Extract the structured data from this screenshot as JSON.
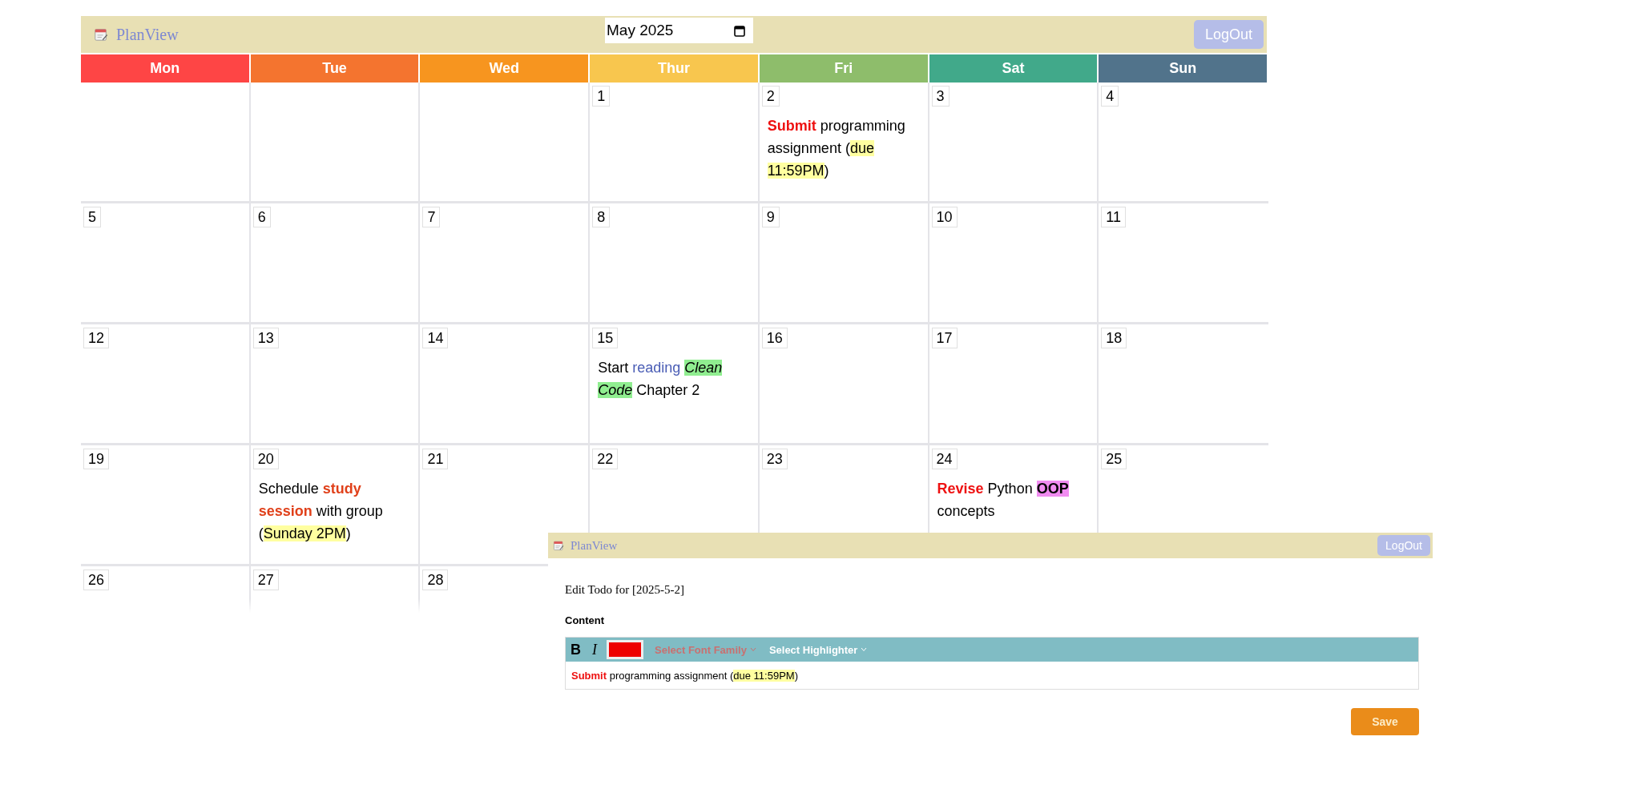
{
  "app": {
    "logo_text": "PlanView",
    "month": "May 2025",
    "logout": "LogOut"
  },
  "weekdays": [
    {
      "label": "Mon",
      "color": "#fe4545"
    },
    {
      "label": "Tue",
      "color": "#f4742f"
    },
    {
      "label": "Wed",
      "color": "#f7951f"
    },
    {
      "label": "Thur",
      "color": "#f8c64e"
    },
    {
      "label": "Fri",
      "color": "#8ebd6b"
    },
    {
      "label": "Sat",
      "color": "#41a98a"
    },
    {
      "label": "Sun",
      "color": "#51738b"
    }
  ],
  "weeks": [
    [
      {
        "kind": "blank"
      },
      {
        "kind": "blank"
      },
      {
        "kind": "blank"
      },
      {
        "kind": "day",
        "day": "1"
      },
      {
        "kind": "day",
        "day": "2",
        "todo": [
          {
            "text": "Submit",
            "bold": true,
            "color": "#ee1111"
          },
          {
            "text": " programming assignment ("
          },
          {
            "text": "due 11:59PM",
            "highlight": {
              "color": "#ffffa0"
            }
          },
          {
            "text": ")"
          }
        ]
      },
      {
        "kind": "day",
        "day": "3"
      },
      {
        "kind": "day",
        "day": "4"
      }
    ],
    [
      {
        "kind": "day",
        "day": "5"
      },
      {
        "kind": "day",
        "day": "6"
      },
      {
        "kind": "day",
        "day": "7"
      },
      {
        "kind": "day",
        "day": "8"
      },
      {
        "kind": "day",
        "day": "9"
      },
      {
        "kind": "day",
        "day": "10"
      },
      {
        "kind": "day",
        "day": "11"
      }
    ],
    [
      {
        "kind": "day",
        "day": "12"
      },
      {
        "kind": "day",
        "day": "13"
      },
      {
        "kind": "day",
        "day": "14"
      },
      {
        "kind": "day",
        "day": "15",
        "todo": [
          {
            "text": "Start "
          },
          {
            "text": "reading ",
            "color": "#4a5db5"
          },
          {
            "text": "Clean Code",
            "italic": true,
            "highlight": {
              "color": "#90ee90"
            }
          },
          {
            "text": " Chapter 2"
          }
        ]
      },
      {
        "kind": "day",
        "day": "16"
      },
      {
        "kind": "day",
        "day": "17"
      },
      {
        "kind": "day",
        "day": "18"
      }
    ],
    [
      {
        "kind": "day",
        "day": "19"
      },
      {
        "kind": "day",
        "day": "20",
        "todo": [
          {
            "text": "Schedule "
          },
          {
            "text": "study session",
            "bold": true,
            "color": "#e0401a"
          },
          {
            "text": " with group ("
          },
          {
            "text": "Sunday 2PM",
            "highlight": {
              "color": "#ffffa0"
            }
          },
          {
            "text": ")"
          }
        ]
      },
      {
        "kind": "day",
        "day": "21"
      },
      {
        "kind": "day",
        "day": "22"
      },
      {
        "kind": "day",
        "day": "23"
      },
      {
        "kind": "day",
        "day": "24",
        "todo": [
          {
            "text": "Revise",
            "bold": true,
            "color": "#ee1111"
          },
          {
            "text": " Python "
          },
          {
            "text": "OOP",
            "bold": true,
            "highlight": {
              "color": "#f08cf0"
            }
          },
          {
            "text": " concepts"
          }
        ]
      },
      {
        "kind": "day",
        "day": "25"
      }
    ],
    [
      {
        "kind": "day",
        "day": "26"
      },
      {
        "kind": "day",
        "day": "27"
      },
      {
        "kind": "day",
        "day": "28"
      }
    ]
  ],
  "editor_window": {
    "app": {
      "logo_text": "PlanView",
      "logout": "LogOut"
    },
    "heading": "Edit Todo for [2025-5-2]",
    "content_label": "Content",
    "toolbar": {
      "bold": "B",
      "italic": "I",
      "swatch": {
        "color": "#ee0000"
      },
      "font_family": "Select Font Family",
      "highlighter": "Select Highlighter"
    },
    "content": [
      {
        "text": "Submit",
        "bold": true,
        "color": "#ee1111"
      },
      {
        "text": " programming assignment ("
      },
      {
        "text": "due 11:59PM",
        "highlight": {
          "color": "#ffffa0"
        }
      },
      {
        "text": ")"
      }
    ],
    "save": "Save"
  }
}
